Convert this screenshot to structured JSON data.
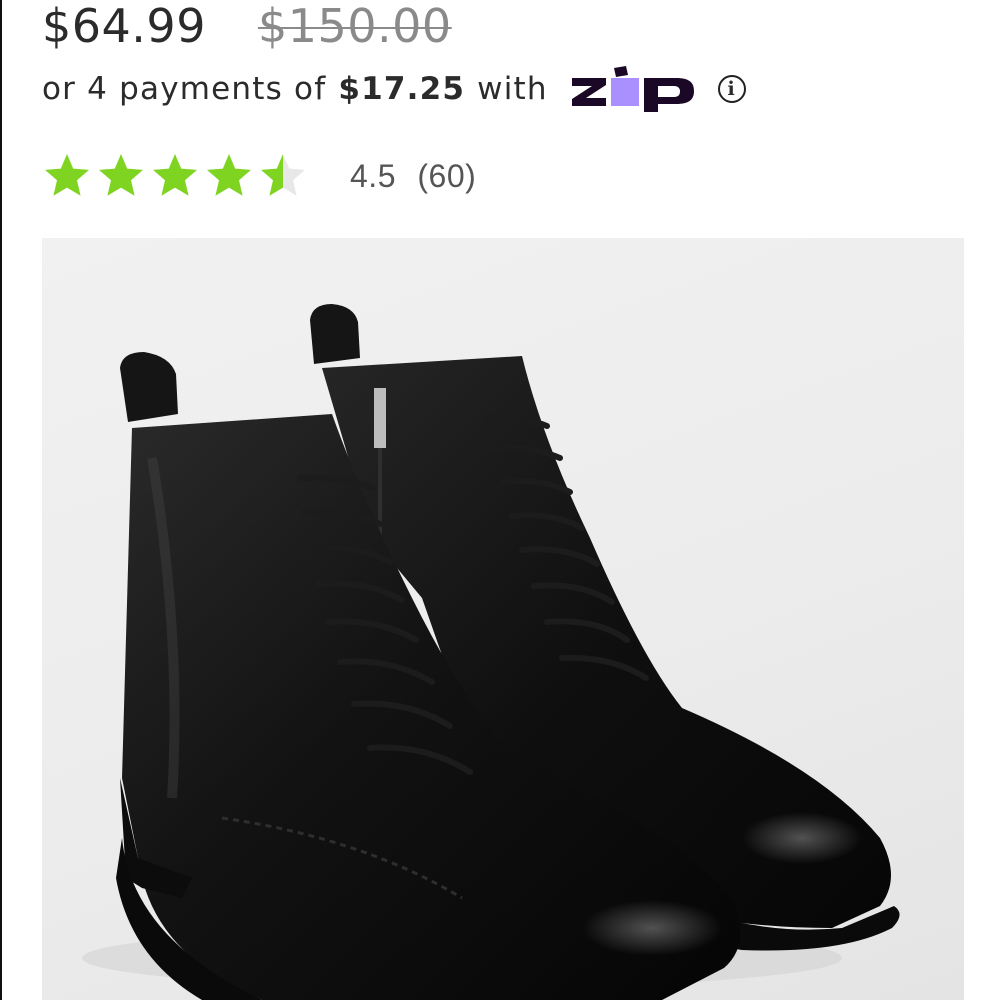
{
  "product": {
    "price_current": "$64.99",
    "price_original": "$150.00"
  },
  "installments": {
    "prefix": "or 4 payments of",
    "amount": "$17.25",
    "suffix": "with",
    "provider": "zip",
    "provider_colors": {
      "dark": "#1a0826",
      "accent": "#aa8fff"
    },
    "info_icon": "info-icon"
  },
  "rating": {
    "value": "4.5",
    "count": "(60)",
    "stars_filled": 4.5,
    "stars_total": 5,
    "star_color": "#7fd321",
    "star_empty_color": "#e8e8e8"
  },
  "image": {
    "subject": "black-lace-up-leather-boots-icon"
  }
}
